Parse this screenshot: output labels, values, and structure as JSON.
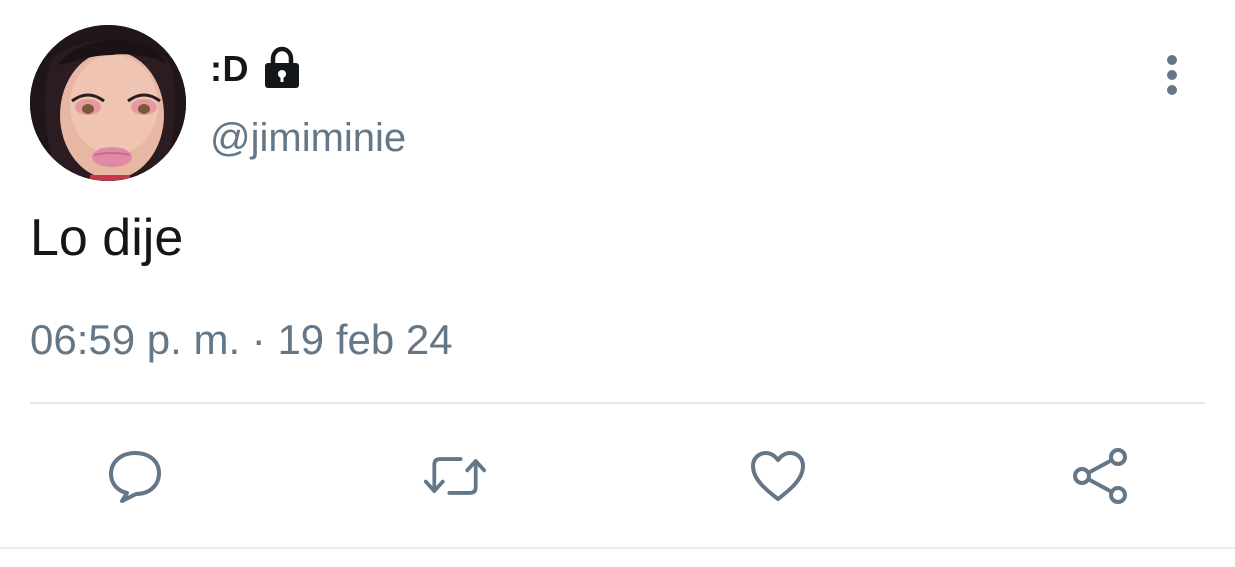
{
  "tweet": {
    "display_name": ":D",
    "handle": "@jimiminie",
    "text": "Lo dije",
    "timestamp": "06:59 p. m. · 19 feb 24",
    "protected": true
  },
  "icons": {
    "lock": "lock-icon",
    "more": "more-vertical-icon",
    "reply": "reply-icon",
    "retweet": "retweet-icon",
    "like": "heart-icon",
    "share": "share-icon"
  },
  "colors": {
    "text_primary": "#14171a",
    "text_secondary": "#657786",
    "divider": "#e1e8ed"
  }
}
